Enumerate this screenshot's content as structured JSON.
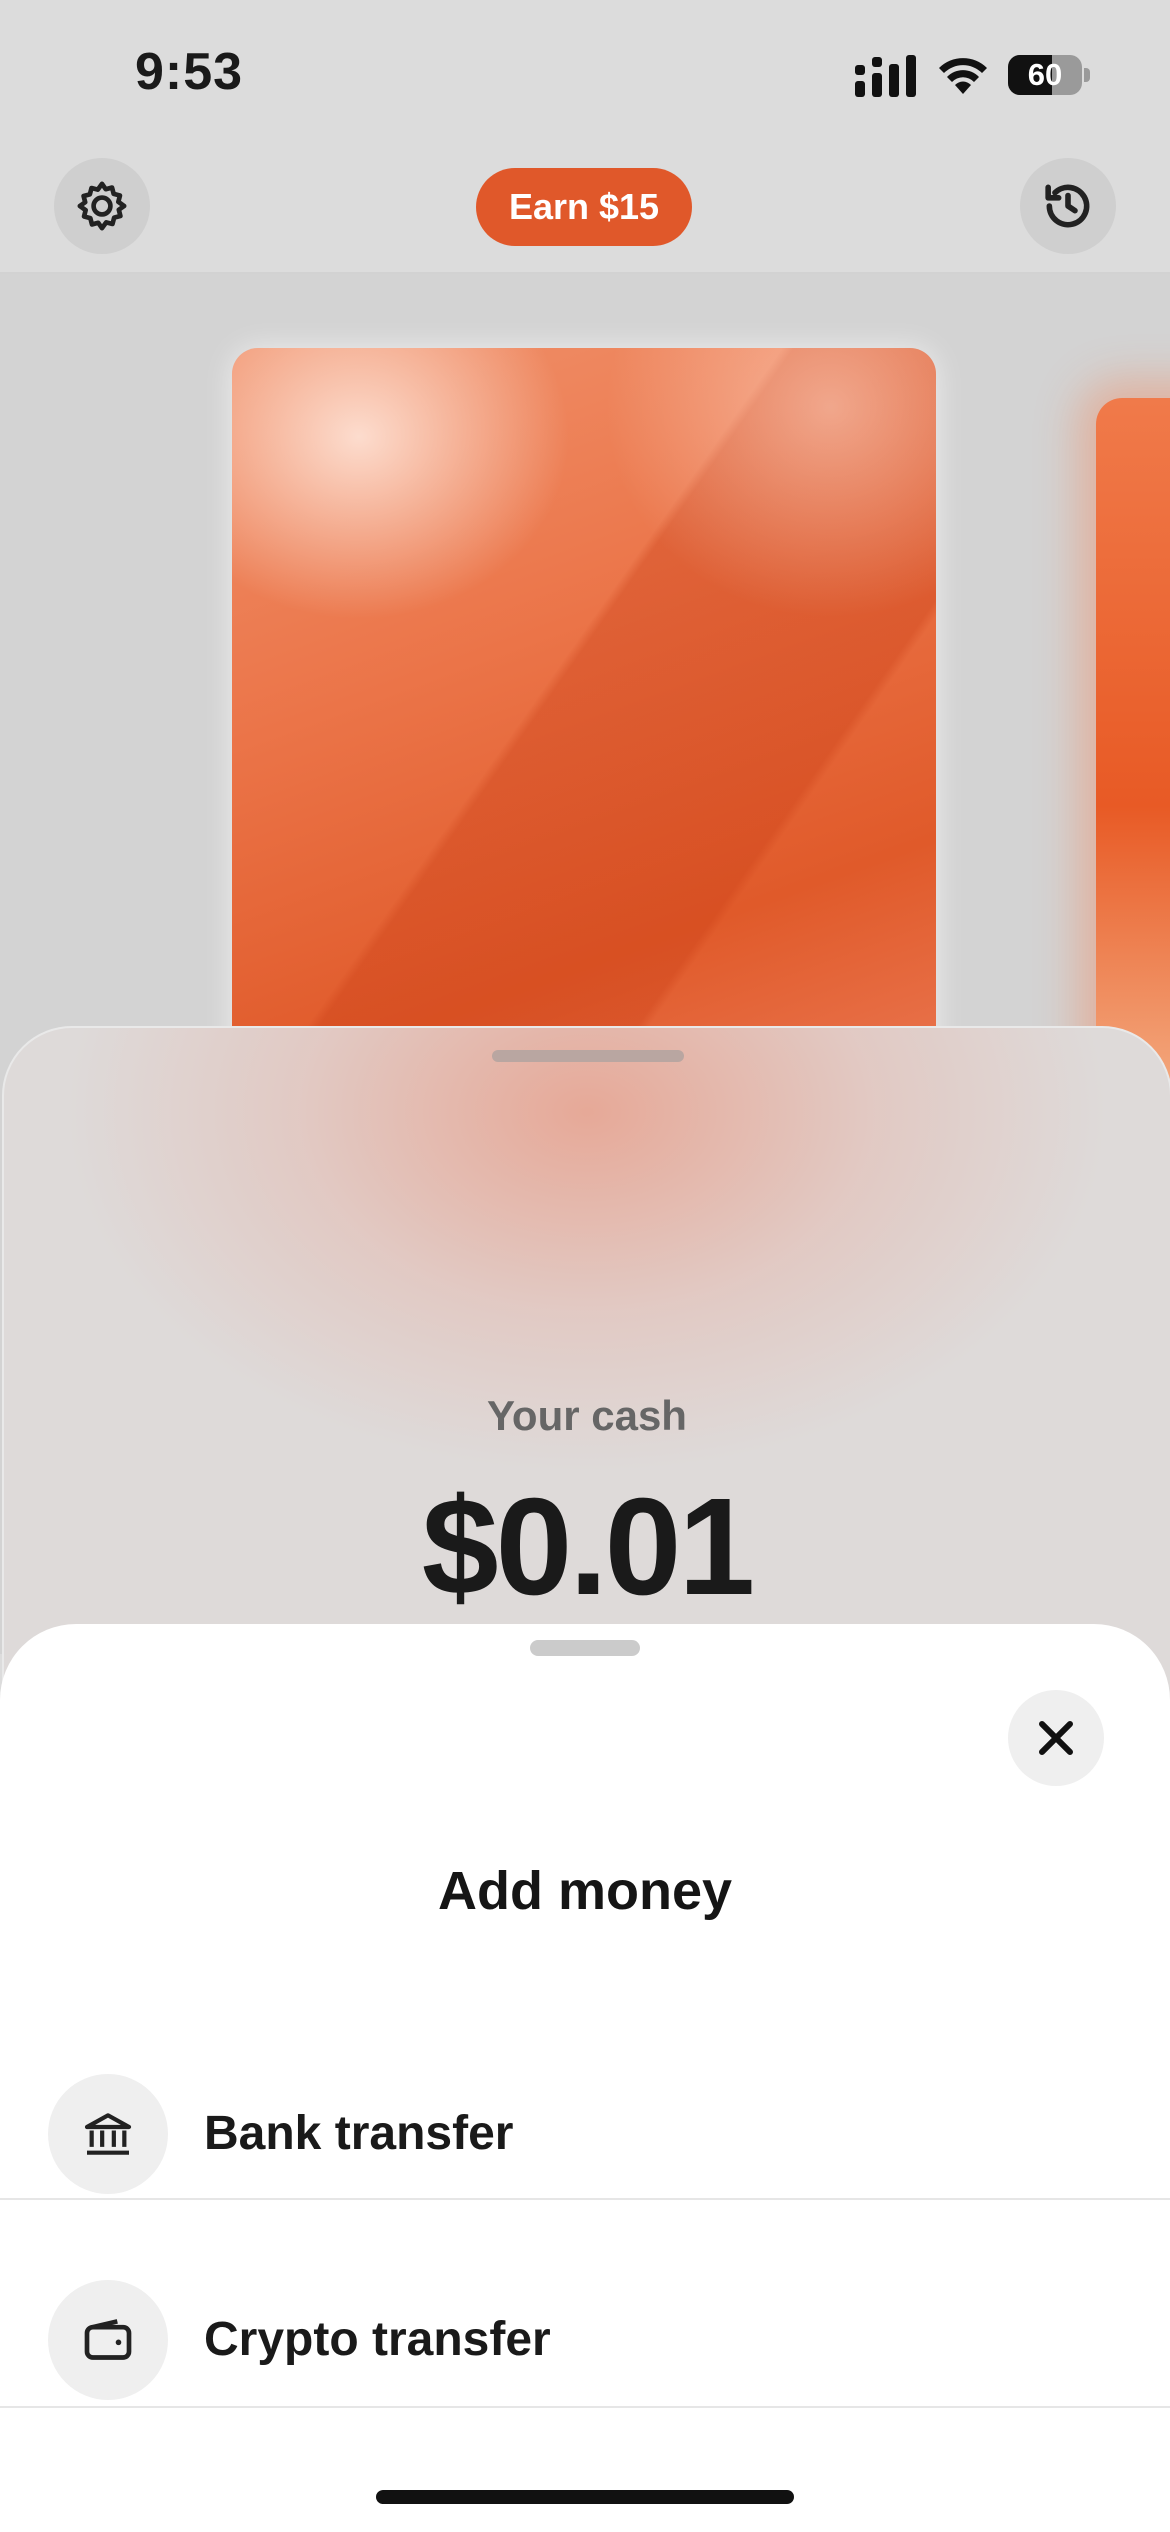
{
  "status_bar": {
    "time": "9:53",
    "battery": "60",
    "battery_level": 0.6
  },
  "header": {
    "earn_label": "Earn $15"
  },
  "icons": {
    "settings": "gear-icon",
    "history": "history-clock-icon",
    "close": "close-icon",
    "bank": "bank-icon",
    "crypto": "wallet-icon"
  },
  "cash": {
    "label": "Your cash",
    "amount": "$0.01"
  },
  "modal": {
    "title": "Add money",
    "options": [
      {
        "label": "Bank transfer",
        "icon": "bank-icon"
      },
      {
        "label": "Crypto transfer",
        "icon": "wallet-icon"
      }
    ]
  },
  "colors": {
    "accent": "#E0582A",
    "card_orange": "#EB7448",
    "modal_bg": "#FFFFFF"
  }
}
